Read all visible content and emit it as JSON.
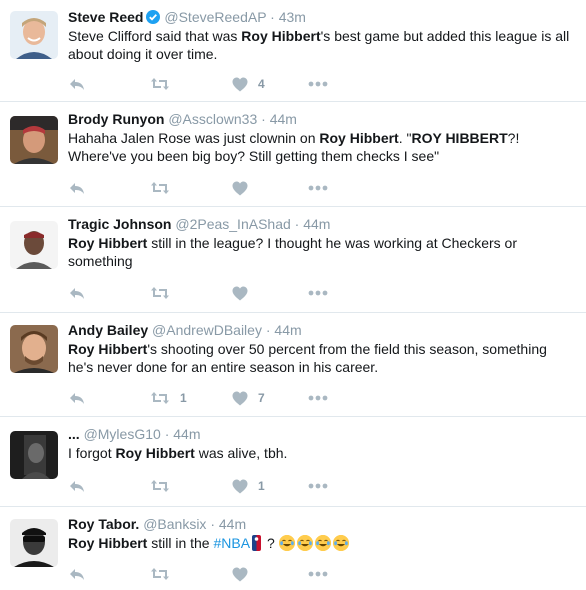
{
  "tweets": [
    {
      "name": "Steve Reed",
      "verified": true,
      "handle": "@SteveReedAP",
      "sep": "·",
      "time": "43m",
      "text_parts": [
        "Steve Clifford said that was ",
        "Roy Hibbert",
        "'s best game but added this league is all about doing it over time."
      ],
      "retweets": "",
      "likes": "4"
    },
    {
      "name": "Brody Runyon",
      "handle": "@Assclown33",
      "sep": "·",
      "time": "44m",
      "text_parts": [
        "Hahaha Jalen Rose was just clownin on ",
        "Roy Hibbert",
        ". \"",
        "ROY HIBBERT",
        "?! Where've you been big boy? Still getting them checks I see\""
      ],
      "retweets": "",
      "likes": ""
    },
    {
      "name": "Tragic Johnson",
      "handle": "@2Peas_InAShad",
      "sep": "·",
      "time": "44m",
      "text_parts": [
        "Roy Hibbert",
        " still in the league? I thought he was working at Checkers or something"
      ],
      "retweets": "",
      "likes": ""
    },
    {
      "name": "Andy Bailey",
      "handle": "@AndrewDBailey",
      "sep": "·",
      "time": "44m",
      "text_parts": [
        "Roy Hibbert",
        "'s shooting over 50 percent from the field this season, something he's never done for an entire season in his career."
      ],
      "retweets": "1",
      "likes": "7"
    },
    {
      "name": "...",
      "handle": "@MylesG10",
      "sep": "·",
      "time": "44m",
      "text_parts": [
        "I forgot ",
        "Roy Hibbert",
        " was alive, tbh."
      ],
      "retweets": "",
      "likes": "1"
    },
    {
      "name": "Roy Tabor.",
      "handle": "@Banksix",
      "sep": "·",
      "time": "44m",
      "text_parts": [
        "Roy Hibbert",
        " still in the ",
        "#NBA",
        " ? "
      ],
      "retweets": "",
      "likes": ""
    }
  ],
  "icons": {
    "reply": "reply-icon",
    "retweet": "retweet-icon",
    "like": "heart-icon",
    "more": "more-icon",
    "verified": "verified-badge-icon"
  },
  "colors": {
    "name": "#14171a",
    "muted": "#8899a6",
    "icon": "#aab8c2",
    "verified": "#1da1f2",
    "hashtag": "#1b95e0",
    "divider": "#e1e8ed"
  }
}
